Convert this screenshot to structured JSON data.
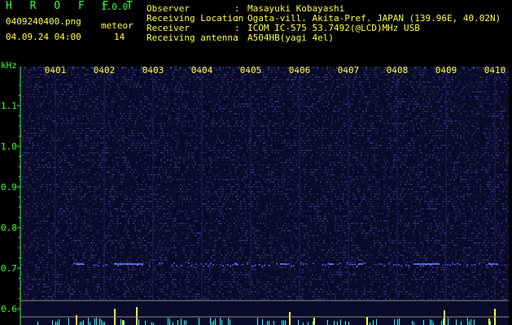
{
  "app": {
    "title": "H R O F F T",
    "version": "1.0.0",
    "filename": "0409240400.png",
    "datetime": "04.09.24 04:00",
    "meteor_label": "meteor",
    "meteor_count": "14"
  },
  "info": [
    {
      "label": "Observer",
      "sep": ":",
      "value": "Masayuki Kobayashi"
    },
    {
      "label": "Receiving Location",
      "sep": ":",
      "value": "Ogata-vill. Akita-Pref. JAPAN (139.96E, 40.02N)"
    },
    {
      "label": "Receiver",
      "sep": ":",
      "value": "ICOM IC-575 53.7492(@LCD)MHz USB"
    },
    {
      "label": "Receiving antenna",
      "sep": ":",
      "value": "A504HB(yagi 4el)"
    }
  ],
  "colors": {
    "background": "#000000",
    "text_green": "#33ff33",
    "text_yellow": "#ffff33",
    "noise_blue": "#1a1a6e",
    "signal_blue": "#4a5aff",
    "spike_yellow": "#ffff33",
    "spike_cyan": "#33ffff"
  },
  "chart_data": {
    "type": "heatmap",
    "ylabel": "kHz",
    "time_ticks": [
      "0401",
      "0402",
      "0403",
      "0404",
      "0405",
      "0406",
      "0407",
      "0408",
      "0409",
      "0410"
    ],
    "freq_ticks": [
      "1.1",
      "1.0",
      "0.9",
      "0.8",
      "0.7",
      "0.6"
    ],
    "freq_range": [
      0.57,
      1.17
    ],
    "signal_frequency": 0.71,
    "reference_line_frequency": 0.62
  }
}
